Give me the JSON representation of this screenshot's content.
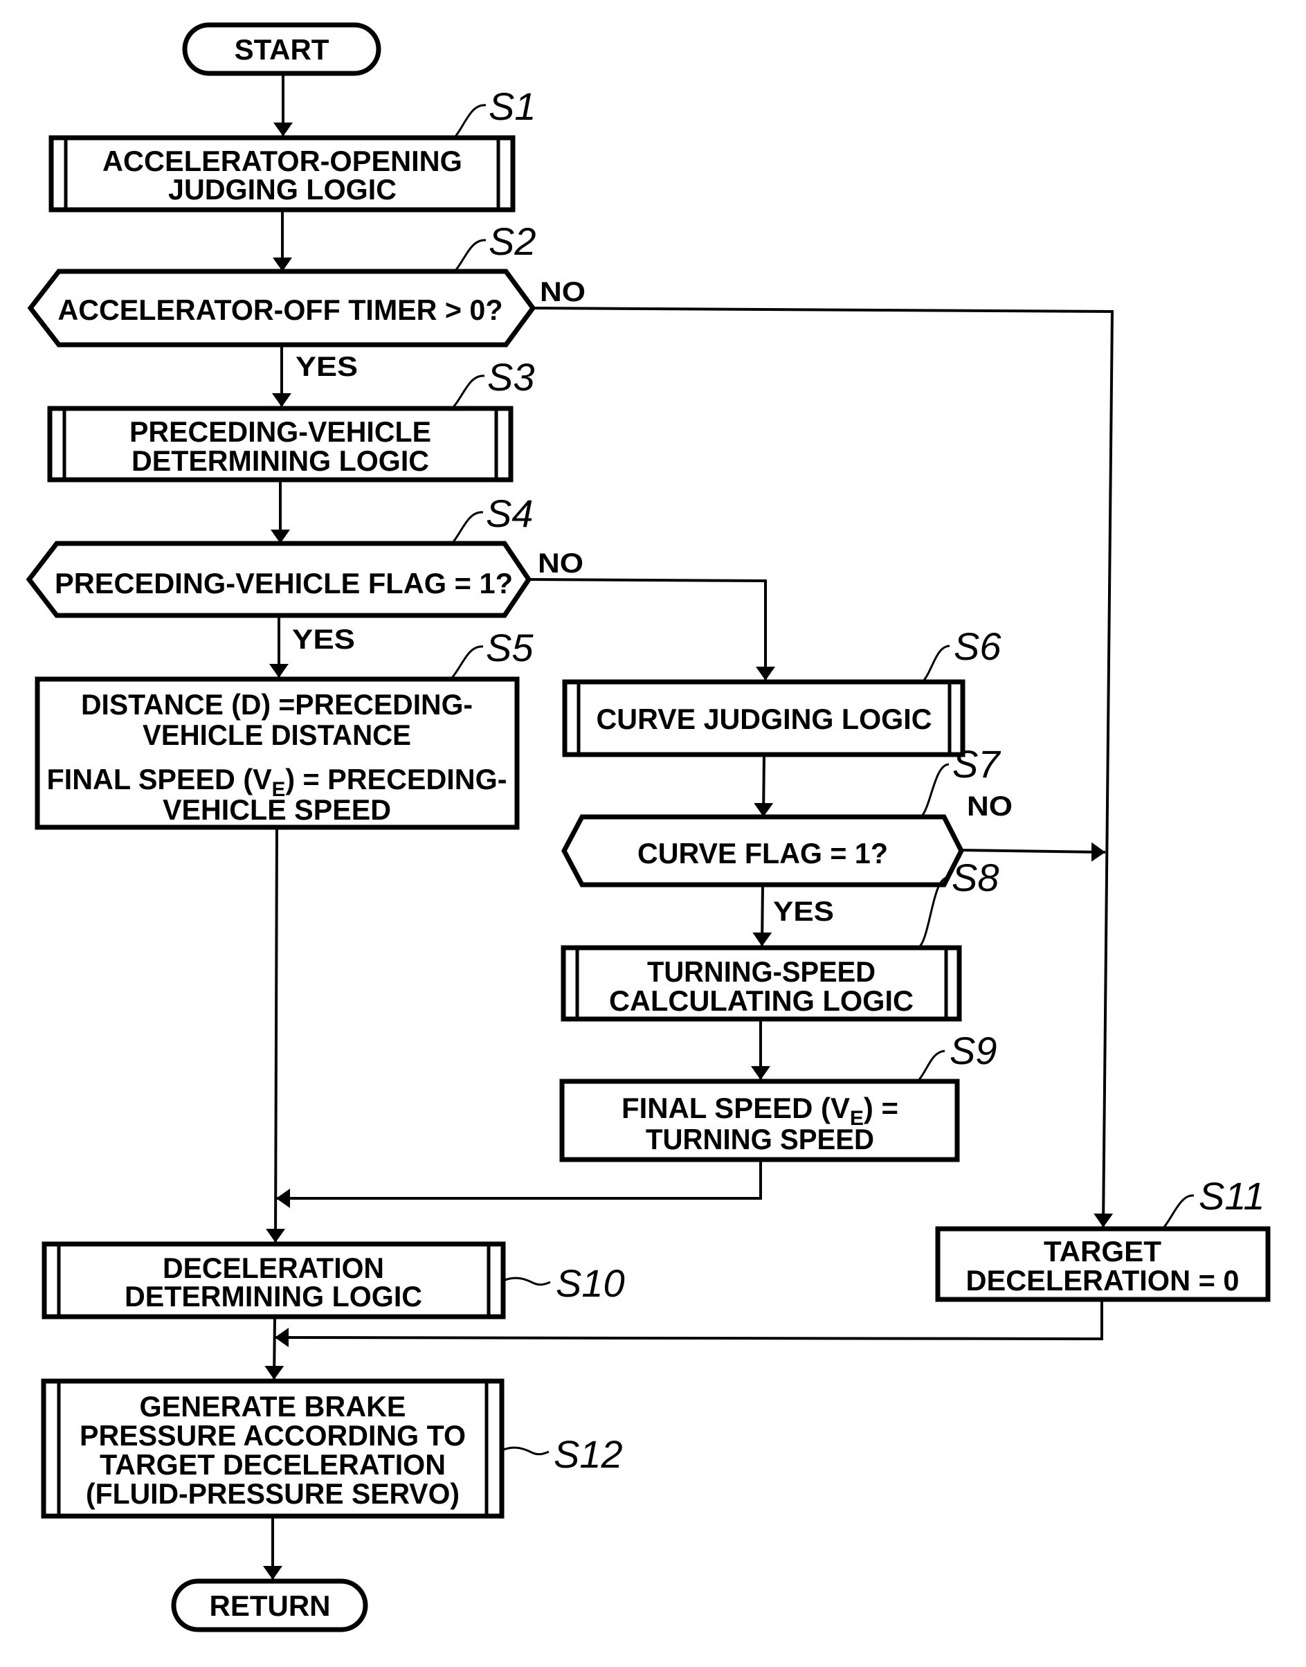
{
  "figure": {
    "terminals": {
      "start": "START",
      "return": "RETURN"
    },
    "steps": {
      "S1": {
        "label": "S1",
        "lines": [
          "ACCELERATOR-OPENING",
          "JUDGING LOGIC"
        ]
      },
      "S2": {
        "label": "S2",
        "lines": [
          "ACCELERATOR-OFF TIMER > 0?"
        ],
        "yes": "YES",
        "no": "NO"
      },
      "S3": {
        "label": "S3",
        "lines": [
          "PRECEDING-VEHICLE",
          "DETERMINING LOGIC"
        ]
      },
      "S4": {
        "label": "S4",
        "lines": [
          "PRECEDING-VEHICLE FLAG = 1?"
        ],
        "yes": "YES",
        "no": "NO"
      },
      "S5": {
        "label": "S5",
        "lines": [
          "DISTANCE (D) =PRECEDING-",
          "VEHICLE DISTANCE"
        ],
        "line3_pre": "FINAL SPEED (V",
        "line3_sub": "E",
        "line3_post": ") = PRECEDING-",
        "line4": "VEHICLE SPEED"
      },
      "S6": {
        "label": "S6",
        "lines": [
          "CURVE JUDGING LOGIC"
        ]
      },
      "S7": {
        "label": "S7",
        "lines": [
          "CURVE FLAG = 1?"
        ],
        "yes": "YES",
        "no": "NO"
      },
      "S8": {
        "label": "S8",
        "lines": [
          "TURNING-SPEED",
          "CALCULATING LOGIC"
        ]
      },
      "S9": {
        "label": "S9",
        "line1_pre": "FINAL SPEED (V",
        "line1_sub": "E",
        "line1_post": ") =",
        "line2": "TURNING SPEED"
      },
      "S10": {
        "label": "S10",
        "lines": [
          "DECELERATION",
          "DETERMINING LOGIC"
        ]
      },
      "S11": {
        "label": "S11",
        "lines": [
          "TARGET",
          "DECELERATION = 0"
        ]
      },
      "S12": {
        "label": "S12",
        "lines": [
          "GENERATE BRAKE",
          "PRESSURE ACCORDING TO",
          "TARGET DECELERATION",
          "(FLUID-PRESSURE SERVO)"
        ]
      }
    }
  }
}
